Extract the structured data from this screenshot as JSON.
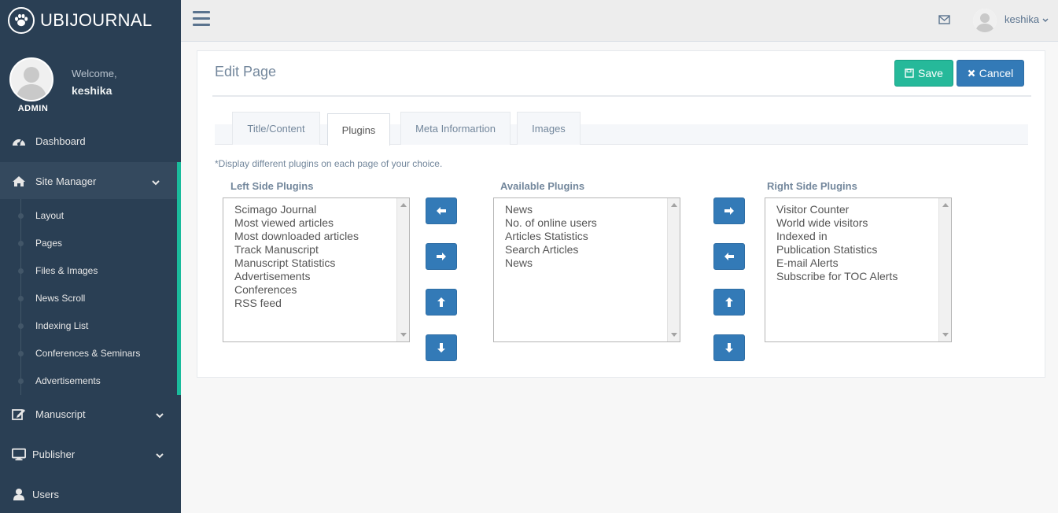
{
  "brand": {
    "name": "UBIJOURNAL",
    "logo_icon": "paw-icon"
  },
  "profile": {
    "welcome": "Welcome,",
    "username": "keshika",
    "role": "ADMIN"
  },
  "nav": {
    "dashboard": "Dashboard",
    "site_manager": "Site Manager",
    "site_manager_items": [
      "Layout",
      "Pages",
      "Files & Images",
      "News Scroll",
      "Indexing List",
      "Conferences & Seminars",
      "Advertisements"
    ],
    "manuscript": "Manuscript",
    "publisher": "Publisher",
    "users": "Users"
  },
  "topbar": {
    "username": "keshika",
    "mail_icon": "envelope-icon",
    "menu_icon": "hamburger-icon"
  },
  "page": {
    "title": "Edit Page",
    "save_label": "Save",
    "cancel_label": "Cancel",
    "tabs": [
      "Title/Content",
      "Plugins",
      "Meta Informartion",
      "Images"
    ],
    "active_tab": "Plugins",
    "note": "*Display different plugins on each page of your choice."
  },
  "plugins": {
    "left": {
      "label": "Left Side Plugins",
      "items": [
        "Scimago Journal",
        "Most viewed articles",
        "Most downloaded articles",
        "Track Manuscript",
        "Manuscript Statistics",
        "Advertisements",
        "Conferences",
        "RSS feed"
      ]
    },
    "available": {
      "label": "Available Plugins",
      "items": [
        "News",
        "No. of online users",
        "Articles Statistics",
        "Search Articles",
        "News"
      ]
    },
    "right": {
      "label": "Right Side Plugins",
      "items": [
        "Visitor Counter",
        "World wide visitors",
        "Indexed in",
        "Publication Statistics",
        "E-mail Alerts",
        "Subscribe for TOC Alerts"
      ]
    }
  },
  "colors": {
    "sidebar": "#2a3f54",
    "accent": "#1abb9c",
    "save": "#26b99a",
    "primary": "#337ab7"
  }
}
